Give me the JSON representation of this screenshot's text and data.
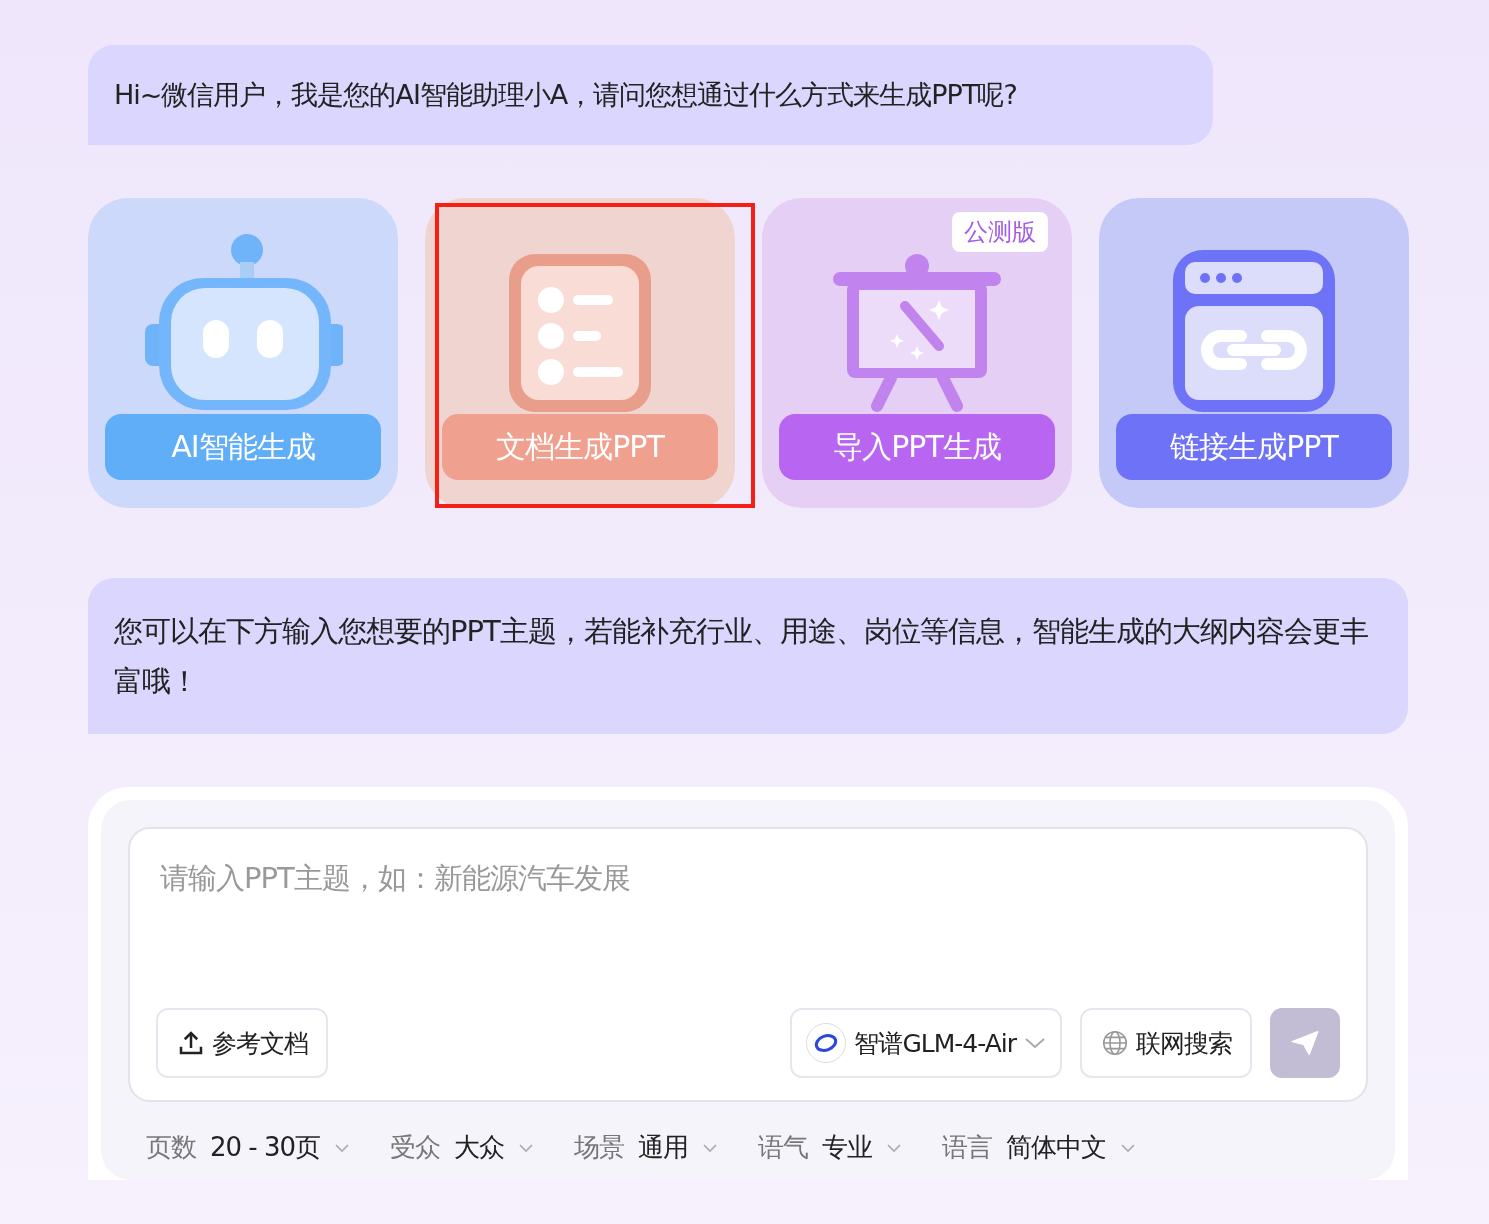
{
  "greeting": "Hi~微信用户，我是您的AI智能助理小A，请问您想通过什么方式来生成PPT呢?",
  "modes": [
    {
      "kind": "robot",
      "label": "AI智能生成",
      "color": "#60aef7",
      "highlighted": false
    },
    {
      "kind": "document",
      "label": "文档生成PPT",
      "color": "#f0a08e",
      "highlighted": true
    },
    {
      "kind": "presentation",
      "label": "导入PPT生成",
      "color": "#b866f2",
      "highlighted": false,
      "badge": "公测版"
    },
    {
      "kind": "link",
      "label": "链接生成PPT",
      "color": "#6d72f7",
      "highlighted": false
    }
  ],
  "hint": "您可以在下方输入您想要的PPT主题，若能补充行业、用途、岗位等信息，智能生成的大纲内容会更丰富哦！",
  "input": {
    "placeholder": "请输入PPT主题，如：新能源汽车发展"
  },
  "upload_button": "参考文档",
  "model_select": "智谱GLM-4-Air",
  "web_search": {
    "label": "联网搜索",
    "on": false
  },
  "send": {
    "disabled": true
  },
  "options": [
    {
      "label": "页数",
      "value": "20 - 30页"
    },
    {
      "label": "受众",
      "value": "大众"
    },
    {
      "label": "场景",
      "value": "通用"
    },
    {
      "label": "语气",
      "value": "专业"
    },
    {
      "label": "语言",
      "value": "简体中文"
    }
  ]
}
